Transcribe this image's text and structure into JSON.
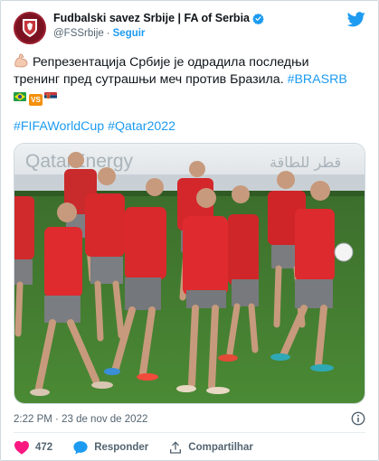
{
  "account": {
    "display_name": "Fudbalski savez Srbije | FA of Serbia",
    "handle": "@FSSrbije",
    "separator": "·",
    "follow_label": "Seguir",
    "verified": true
  },
  "tweet": {
    "line1": "Репрезентација Србије је одрадила последњи",
    "line2_text": "тренинг пред сутрашњи меч против Бразила. ",
    "line2_hashtag": "#BRASRB",
    "vs_badge": "VS",
    "hashtags_line": "#FIFAWorldCup #Qatar2022",
    "emoji_icon": "flexed-biceps-emoji",
    "flags": [
      "brazil-flag",
      "serbia-flag"
    ]
  },
  "media": {
    "banner_text": "QatarEnergy",
    "banner_arabic": "قطر للطاقة"
  },
  "meta": {
    "time": "2:22 PM",
    "separator": "·",
    "date": "23 de nov de 2022"
  },
  "actions": {
    "likes_count": "472",
    "reply_label": "Responder",
    "share_label": "Compartilhar"
  },
  "colors": {
    "accent": "#1d9bf0",
    "like": "#f91880",
    "text": "#0f1419",
    "muted": "#536471",
    "kit_red": "#e0262b",
    "pitch": "#3f7a2e"
  }
}
